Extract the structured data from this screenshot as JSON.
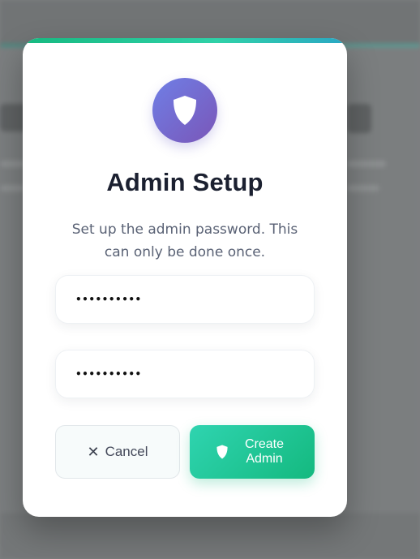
{
  "dialog": {
    "title": "Admin Setup",
    "description": "Set up the admin password. This can only be done once.",
    "icon": "shield-icon",
    "accent_gradient": [
      "#6f7fe6",
      "#7a56b8"
    ]
  },
  "form": {
    "password_value": "••••••••••",
    "confirm_password_value": "••••••••••"
  },
  "actions": {
    "cancel_label": "Cancel",
    "cancel_icon": "close-icon",
    "create_label": "Create Admin",
    "create_icon": "shield-icon",
    "create_color": "#14b97f"
  }
}
